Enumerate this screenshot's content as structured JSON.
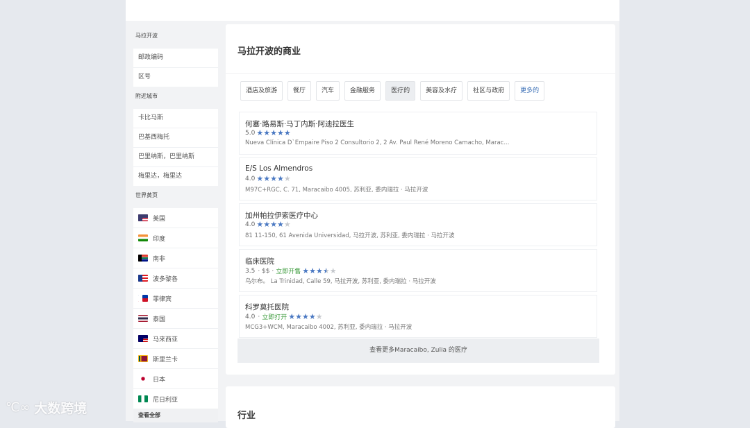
{
  "sidebar": {
    "sections": [
      {
        "heading": "马拉开波",
        "links": [
          "邮政编码",
          "区号"
        ]
      },
      {
        "heading": "附近城市",
        "links": [
          "卡比马斯",
          "巴基西梅托",
          "巴里纳斯，巴里纳斯",
          "梅里达，梅里达"
        ]
      }
    ],
    "world_heading": "世界黄页",
    "countries": [
      {
        "label": "美国",
        "flag": "us"
      },
      {
        "label": "印度",
        "flag": "in"
      },
      {
        "label": "南非",
        "flag": "za"
      },
      {
        "label": "波多黎各",
        "flag": "pr"
      },
      {
        "label": "菲律宾",
        "flag": "ph"
      },
      {
        "label": "泰国",
        "flag": "th"
      },
      {
        "label": "马来西亚",
        "flag": "my"
      },
      {
        "label": "斯里兰卡",
        "flag": "lk"
      },
      {
        "label": "日本",
        "flag": "jp"
      },
      {
        "label": "尼日利亚",
        "flag": "ng"
      }
    ],
    "view_all": "查看全部"
  },
  "main": {
    "title": "马拉开波的商业",
    "tabs": [
      {
        "label": "酒店及旅游",
        "active": false
      },
      {
        "label": "餐厅",
        "active": false
      },
      {
        "label": "汽车",
        "active": false
      },
      {
        "label": "金融服务",
        "active": false
      },
      {
        "label": "医疗的",
        "active": true
      },
      {
        "label": "美容及水疗",
        "active": false
      },
      {
        "label": "社区与政府",
        "active": false
      },
      {
        "label": "更多的",
        "active": false,
        "more": true
      }
    ],
    "listings": [
      {
        "name": "何塞·路易斯·马丁内斯·阿迪拉医生",
        "rating": "5.0",
        "stars": 5,
        "price": "",
        "open": "",
        "address": "Nueva Clínica D`Empaire Piso 2 Consultorio 2, 2 Av. Paul René Moreno Camacho, Marac..."
      },
      {
        "name": "E/S Los Almendros",
        "rating": "4.0",
        "stars": 4,
        "price": "",
        "open": "",
        "address": "M97C+RGC, C. 71, Maracaibo 4005, 苏利亚, 委内瑞拉 · 马拉开波"
      },
      {
        "name": "加州帕拉伊索医疗中心",
        "rating": "4.0",
        "stars": 4,
        "price": "",
        "open": "",
        "address": "81 11-150, 61 Avenida Universidad, 马拉开波, 苏利亚, 委内瑞拉 · 马拉开波"
      },
      {
        "name": "临床医院",
        "rating": "3.5",
        "stars": 3.5,
        "price": "· $$ ·",
        "open": "立即开售",
        "address": "乌尔布。 La Trinidad, Calle 59, 马拉开波, 苏利亚, 委内瑞拉 · 马拉开波"
      },
      {
        "name": "科罗莫托医院",
        "rating": "4.0",
        "stars": 4,
        "price": "·",
        "open": "立即打开",
        "address": "MCG3+WCM, Maracaibo 4002, 苏利亚, 委内瑞拉 · 马拉开波"
      }
    ],
    "see_more": "查看更多Maracaibo, Zulia 的医疗"
  },
  "section2": {
    "title": "行业"
  },
  "watermark": {
    "text": "大数跨境",
    "logo": "℃∞"
  },
  "colors": {
    "star": "#4a78c2",
    "open": "#3a9a3a",
    "link": "#3b6fb6"
  }
}
